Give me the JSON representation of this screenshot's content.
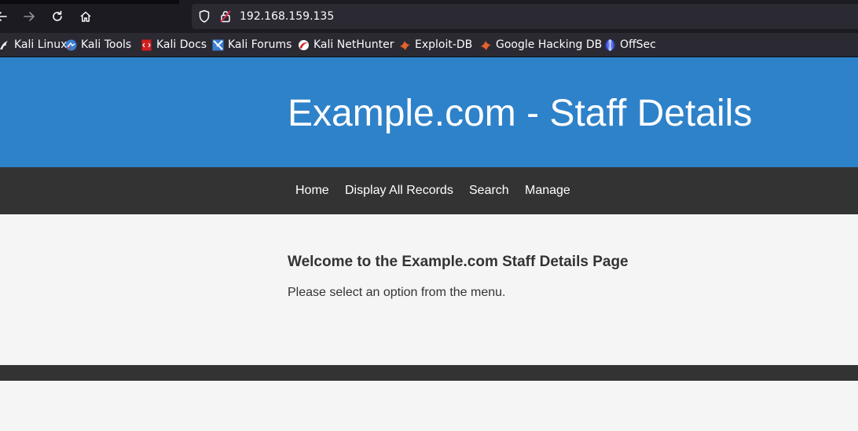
{
  "browser": {
    "url": "192.168.159.135",
    "bookmarks": [
      {
        "label": "Kali Linux",
        "icon": "kali-dragon-icon"
      },
      {
        "label": "Kali Tools",
        "icon": "kali-tools-icon"
      },
      {
        "label": "Kali Docs",
        "icon": "kali-docs-icon"
      },
      {
        "label": "Kali Forums",
        "icon": "kali-forums-icon"
      },
      {
        "label": "Kali NetHunter",
        "icon": "kali-nethunter-icon"
      },
      {
        "label": "Exploit-DB",
        "icon": "exploit-db-icon"
      },
      {
        "label": "Google Hacking DB",
        "icon": "ghdb-icon"
      },
      {
        "label": "OffSec",
        "icon": "offsec-icon"
      }
    ]
  },
  "page": {
    "title": "Example.com - Staff Details",
    "nav": [
      "Home",
      "Display All Records",
      "Search",
      "Manage"
    ],
    "heading": "Welcome to the Example.com Staff Details Page",
    "message": "Please select an option from the menu."
  },
  "colors": {
    "header": "#2e82c9",
    "nav": "#333333",
    "background": "#f5f5f5",
    "browser_toolbar": "#1c1b22",
    "bookmarks_bar": "#2b2a33"
  }
}
